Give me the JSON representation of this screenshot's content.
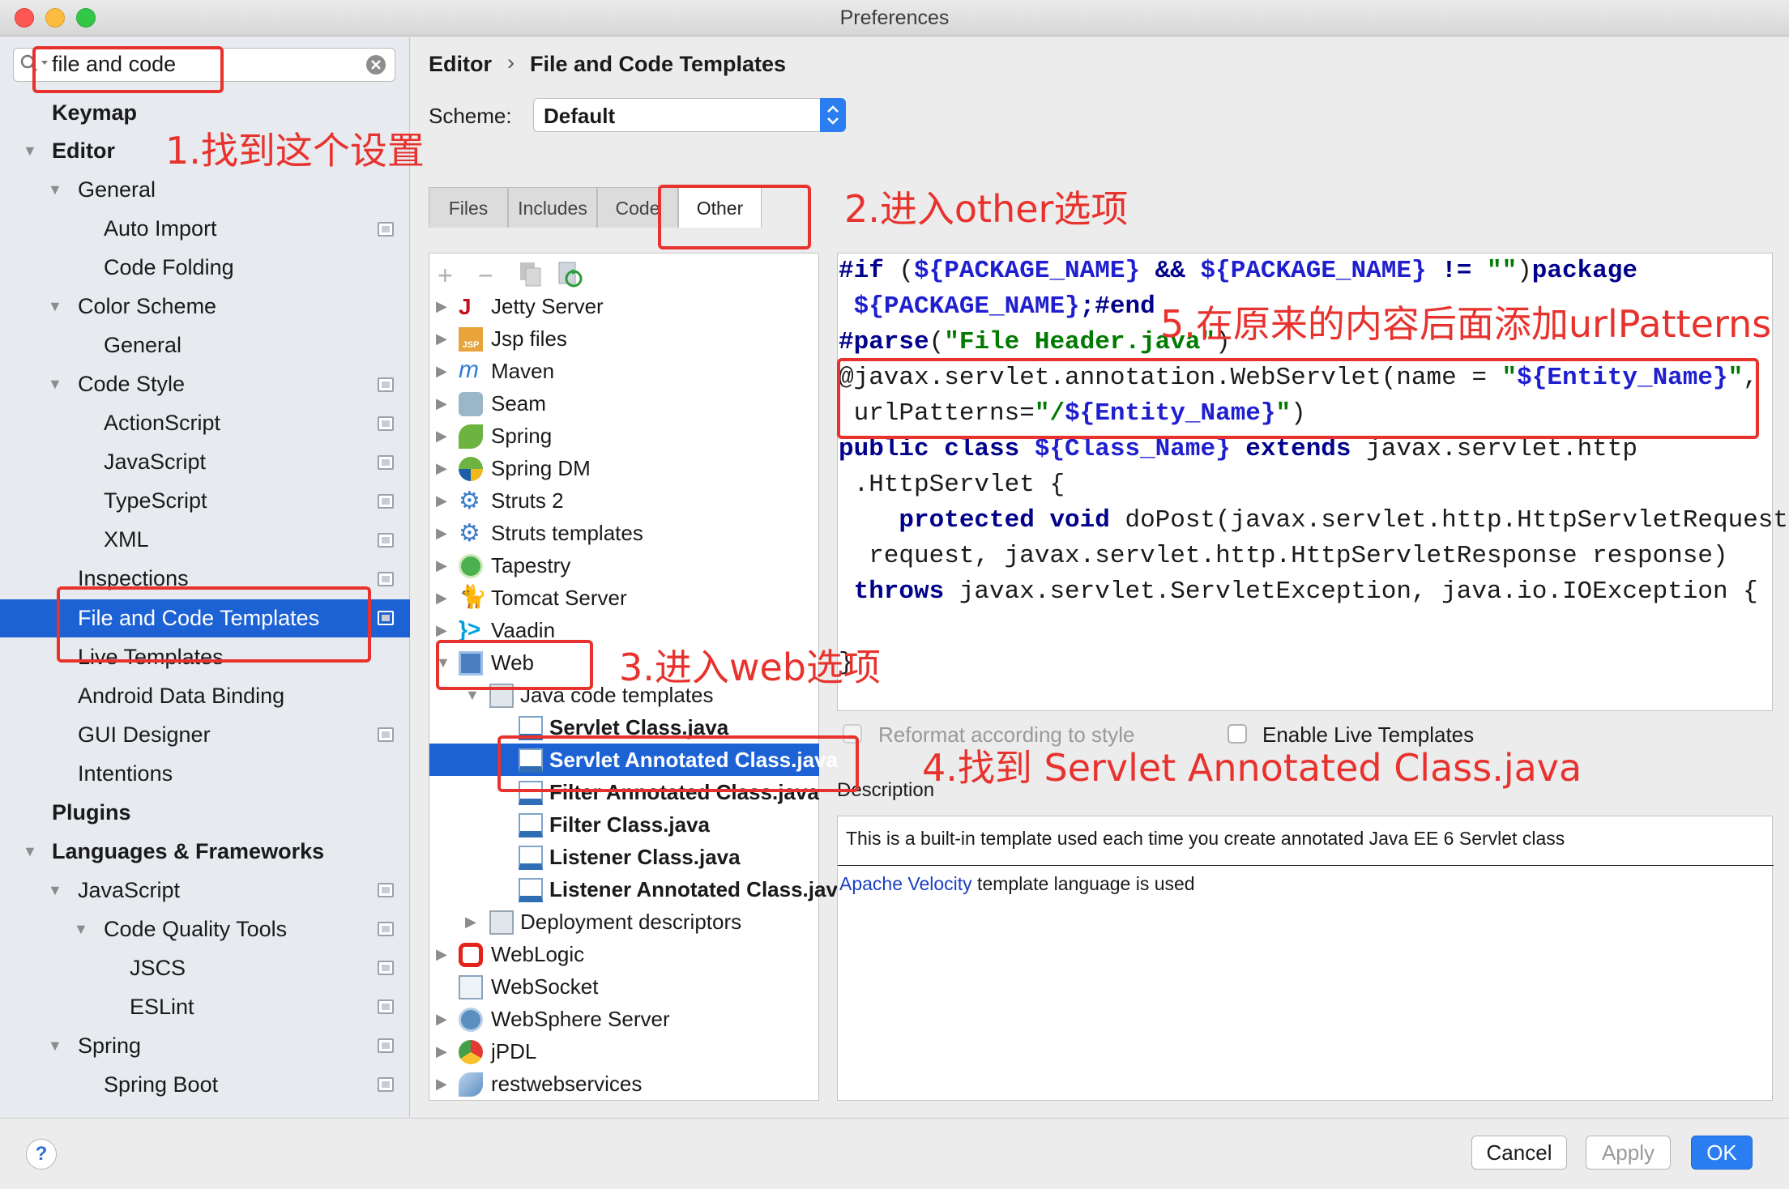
{
  "window": {
    "title": "Preferences"
  },
  "search": {
    "value": "file and code"
  },
  "sidebar": {
    "items": [
      {
        "label": "Keymap"
      },
      {
        "label": "Editor"
      },
      {
        "label": "General"
      },
      {
        "label": "Auto Import"
      },
      {
        "label": "Code Folding"
      },
      {
        "label": "Color Scheme"
      },
      {
        "label": "General"
      },
      {
        "label": "Code Style"
      },
      {
        "label": "ActionScript"
      },
      {
        "label": "JavaScript"
      },
      {
        "label": "TypeScript"
      },
      {
        "label": "XML"
      },
      {
        "label": "Inspections"
      },
      {
        "label": "File and Code Templates"
      },
      {
        "label": "Live Templates"
      },
      {
        "label": "Android Data Binding"
      },
      {
        "label": "GUI Designer"
      },
      {
        "label": "Intentions"
      },
      {
        "label": "Plugins"
      },
      {
        "label": "Languages & Frameworks"
      },
      {
        "label": "JavaScript"
      },
      {
        "label": "Code Quality Tools"
      },
      {
        "label": "JSCS"
      },
      {
        "label": "ESLint"
      },
      {
        "label": "Spring"
      },
      {
        "label": "Spring Boot"
      }
    ]
  },
  "breadcrumb": {
    "parent": "Editor",
    "separator": "›",
    "current": "File and Code Templates"
  },
  "scheme": {
    "label": "Scheme:",
    "value": "Default"
  },
  "tabs": [
    {
      "label": "Files"
    },
    {
      "label": "Includes"
    },
    {
      "label": "Code"
    },
    {
      "label": "Other"
    }
  ],
  "template_tree": {
    "items": [
      {
        "label": "Jetty Server"
      },
      {
        "label": "Jsp files"
      },
      {
        "label": "Maven"
      },
      {
        "label": "Seam"
      },
      {
        "label": "Spring"
      },
      {
        "label": "Spring DM"
      },
      {
        "label": "Struts 2"
      },
      {
        "label": "Struts templates"
      },
      {
        "label": "Tapestry"
      },
      {
        "label": "Tomcat Server"
      },
      {
        "label": "Vaadin"
      },
      {
        "label": "Web"
      },
      {
        "label": "Java code templates"
      },
      {
        "label": "Servlet Class.java"
      },
      {
        "label": "Servlet Annotated Class.java"
      },
      {
        "label": "Filter Annotated Class.java"
      },
      {
        "label": "Filter Class.java"
      },
      {
        "label": "Listener Class.java"
      },
      {
        "label": "Listener Annotated Class.java"
      },
      {
        "label": "Deployment descriptors"
      },
      {
        "label": "WebLogic"
      },
      {
        "label": "WebSocket"
      },
      {
        "label": "WebSphere Server"
      },
      {
        "label": "jPDL"
      },
      {
        "label": "restwebservices"
      }
    ]
  },
  "editor": {
    "lines": [
      [
        {
          "t": "#if",
          "c": "kw"
        },
        {
          "t": " (",
          "c": "ann"
        },
        {
          "t": "${PACKAGE_NAME}",
          "c": "var"
        },
        {
          "t": " && ",
          "c": "kw"
        },
        {
          "t": "${PACKAGE_NAME}",
          "c": "var"
        },
        {
          "t": " != ",
          "c": "kw"
        },
        {
          "t": "\"\"",
          "c": "str"
        },
        {
          "t": ")",
          "c": "ann"
        },
        {
          "t": "package",
          "c": "kw"
        }
      ],
      [
        {
          "t": " ",
          "c": "ann"
        },
        {
          "t": "${PACKAGE_NAME}",
          "c": "var"
        },
        {
          "t": ";",
          "c": "kw"
        },
        {
          "t": "#end",
          "c": "kw"
        }
      ],
      [
        {
          "t": "#parse",
          "c": "kw"
        },
        {
          "t": "(",
          "c": "ann"
        },
        {
          "t": "\"File Header.java\"",
          "c": "str"
        },
        {
          "t": ")",
          "c": "ann"
        }
      ],
      [
        {
          "t": "@javax.servlet.annotation.WebServlet(name = ",
          "c": "ann"
        },
        {
          "t": "\"",
          "c": "str"
        },
        {
          "t": "${Entity_Name}",
          "c": "var"
        },
        {
          "t": "\"",
          "c": "str"
        },
        {
          "t": ",",
          "c": "ann"
        }
      ],
      [
        {
          "t": " urlPatterns=",
          "c": "ann"
        },
        {
          "t": "\"/",
          "c": "str"
        },
        {
          "t": "${Entity_Name}",
          "c": "var"
        },
        {
          "t": "\"",
          "c": "str"
        },
        {
          "t": ")",
          "c": "ann"
        }
      ],
      [
        {
          "t": "public class ",
          "c": "kw"
        },
        {
          "t": "${Class_Name}",
          "c": "var"
        },
        {
          "t": " extends ",
          "c": "kw"
        },
        {
          "t": "javax.servlet.http",
          "c": "ann"
        }
      ],
      [
        {
          "t": " .HttpServlet {",
          "c": "ann"
        }
      ],
      [
        {
          "t": "    protected void ",
          "c": "kw"
        },
        {
          "t": "doPost(javax.servlet.http.HttpServletRequest",
          "c": "ann"
        }
      ],
      [
        {
          "t": "  request, javax.servlet.http.HttpServletResponse response)",
          "c": "ann"
        }
      ],
      [
        {
          "t": " throws ",
          "c": "kw"
        },
        {
          "t": "javax.servlet.ServletException, java.io.IOException {",
          "c": "ann"
        }
      ],
      [
        {
          "t": "",
          "c": "ann"
        }
      ],
      [
        {
          "t": "}",
          "c": "ann"
        }
      ]
    ]
  },
  "options": {
    "reformat": "Reformat according to style",
    "live_templates": "Enable Live Templates"
  },
  "description": {
    "label": "Description",
    "text": "This is a built-in template used each time you create annotated Java EE 6 Servlet class",
    "link": "Apache Velocity",
    "suffix": " template language is used"
  },
  "buttons": {
    "help": "?",
    "cancel": "Cancel",
    "apply": "Apply",
    "ok": "OK"
  },
  "annotations": [
    {
      "text": "1.找到这个设置"
    },
    {
      "text": "2.进入other选项"
    },
    {
      "text": "3.进入web选项"
    },
    {
      "text": "4.找到 Servlet Annotated Class.java"
    },
    {
      "text": "5.在原来的内容后面添加urlPatterns"
    }
  ],
  "colors": {
    "accent": "#1d62d5",
    "annotation": "#e8322d",
    "keyword": "#00008a",
    "string": "#007a00",
    "variable": "#1f1fd0"
  }
}
